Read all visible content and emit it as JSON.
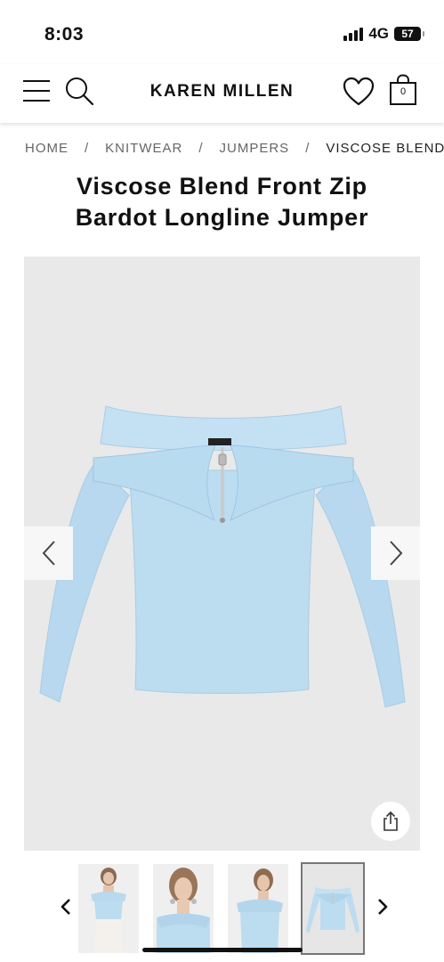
{
  "status_bar": {
    "time": "8:03",
    "network": "4G",
    "battery": "57"
  },
  "header": {
    "brand": "KAREN MILLEN",
    "bag_count": "0",
    "icons": [
      "menu-icon",
      "search-icon",
      "heart-icon",
      "bag-icon"
    ]
  },
  "breadcrumb": {
    "items": [
      "HOME",
      "KNITWEAR",
      "JUMPERS"
    ],
    "current": "VISCOSE BLEND FRONT ZIP BARDOT LONGLINE JUMPER"
  },
  "product": {
    "title_line1": "Viscose Blend Front Zip",
    "title_line2": "Bardot Longline Jumper",
    "color": "#bcdcf0"
  },
  "gallery": {
    "thumbnail_count": 4,
    "selected_index": 3
  },
  "colors": {
    "jumper": "#bcdcf0",
    "image_background": "#e9e9e9",
    "text": "#111111",
    "muted_text": "#666666"
  }
}
